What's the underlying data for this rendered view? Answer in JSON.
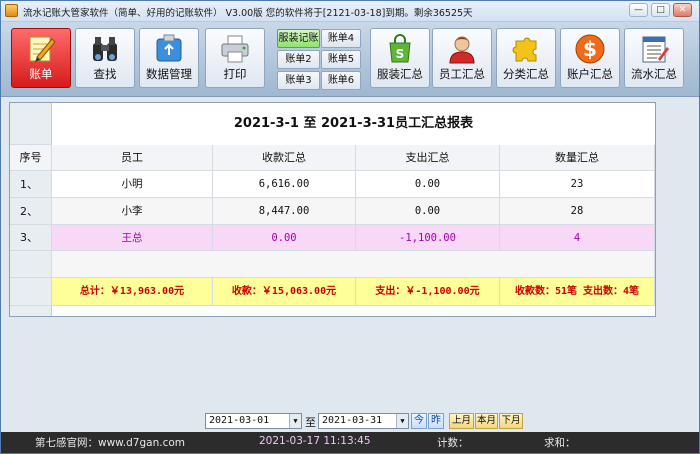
{
  "window": {
    "title": "流水记账大管家软件（简单、好用的记账软件） V3.00版 您的软件将于[2121-03-18]到期。剩余36525天",
    "controls": [
      "minimize",
      "maximize",
      "close"
    ]
  },
  "toolbar": {
    "main_buttons": [
      {
        "label": "账单",
        "icon": "pencil-notepad-icon",
        "active": true
      },
      {
        "label": "查找",
        "icon": "binoculars-icon"
      },
      {
        "label": "数据管理",
        "icon": "usb-drive-icon"
      },
      {
        "label": "打印",
        "icon": "printer-icon"
      }
    ],
    "small_buttons": [
      [
        "服装记账",
        "账单4"
      ],
      [
        "账单2",
        "账单5"
      ],
      [
        "账单3",
        "账单6"
      ]
    ],
    "right_buttons": [
      {
        "label": "服装汇总",
        "icon": "shopping-bag-icon"
      },
      {
        "label": "员工汇总",
        "icon": "employee-icon"
      },
      {
        "label": "分类汇总",
        "icon": "puzzle-icon"
      },
      {
        "label": "账户汇总",
        "icon": "dollar-coin-icon"
      },
      {
        "label": "流水汇总",
        "icon": "ledger-icon"
      }
    ]
  },
  "report": {
    "title": "2021-3-1  至  2021-3-31员工汇总报表",
    "columns": [
      "序号",
      "员工",
      "收款汇总",
      "支出汇总",
      "数量汇总"
    ],
    "rows": [
      {
        "idx": "1、",
        "name": "小明",
        "income": "6,616.00",
        "expense": "0.00",
        "qty": "23"
      },
      {
        "idx": "2、",
        "name": "小李",
        "income": "8,447.00",
        "expense": "0.00",
        "qty": "28"
      },
      {
        "idx": "3、",
        "name": "王总",
        "income": "0.00",
        "expense": "-1,100.00",
        "qty": "4"
      }
    ],
    "summary": {
      "total": "总计：￥13,963.00元",
      "income": "收款：￥15,063.00元",
      "expense": "支出：￥-1,100.00元",
      "counts": "收款数：51笔  支出数：4笔"
    }
  },
  "filter": {
    "start_date": "2021-03-01",
    "to_label": "至",
    "end_date": "2021-03-31",
    "today_label": "今",
    "yesterday_label": "昨",
    "last_month": "上月",
    "this_month": "本月",
    "next_month": "下月"
  },
  "status": {
    "website": "第七感官网：www.d7gan.com",
    "datetime": "2021-03-17 11:13:45",
    "count_label": "计数：",
    "sum_label": "求和："
  },
  "colors": {
    "active_button": "#d61b1b",
    "highlight_row": "#f7d8f7",
    "summary_row": "#ffff9a",
    "status_bar": "#2c2c2c"
  }
}
